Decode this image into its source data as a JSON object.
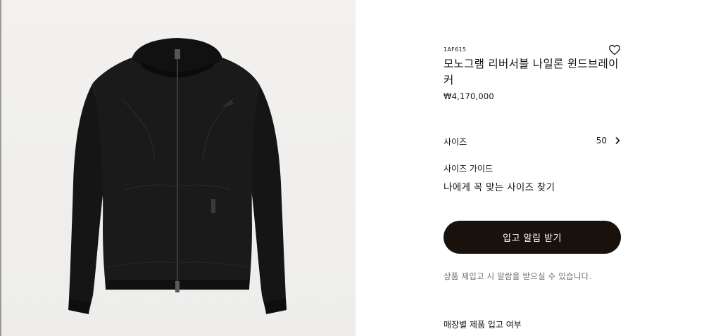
{
  "product": {
    "sku": "1AF615",
    "title": "모노그램 리버서블 나일론 윈드브레이커",
    "price": "₩4,170,000",
    "image_alt": "black hooded zip-up windbreaker"
  },
  "size": {
    "label": "사이즈",
    "value": "50"
  },
  "size_guide": {
    "label": "사이즈 가이드",
    "link": "나에게 꼭 맞는 사이즈 찾기"
  },
  "notify": {
    "button_label": "입고 알림 받기",
    "note": "상품 재입고 시 알람을 받으실 수 있습니다."
  },
  "store": {
    "label": "매장별 제품 입고 여부"
  },
  "icons": {
    "wishlist": "heart-icon",
    "size_chevron": "chevron-right-icon"
  },
  "colors": {
    "primary": "#19110b",
    "image_bg": "#f1f0ee",
    "note": "#6d6d6d"
  }
}
